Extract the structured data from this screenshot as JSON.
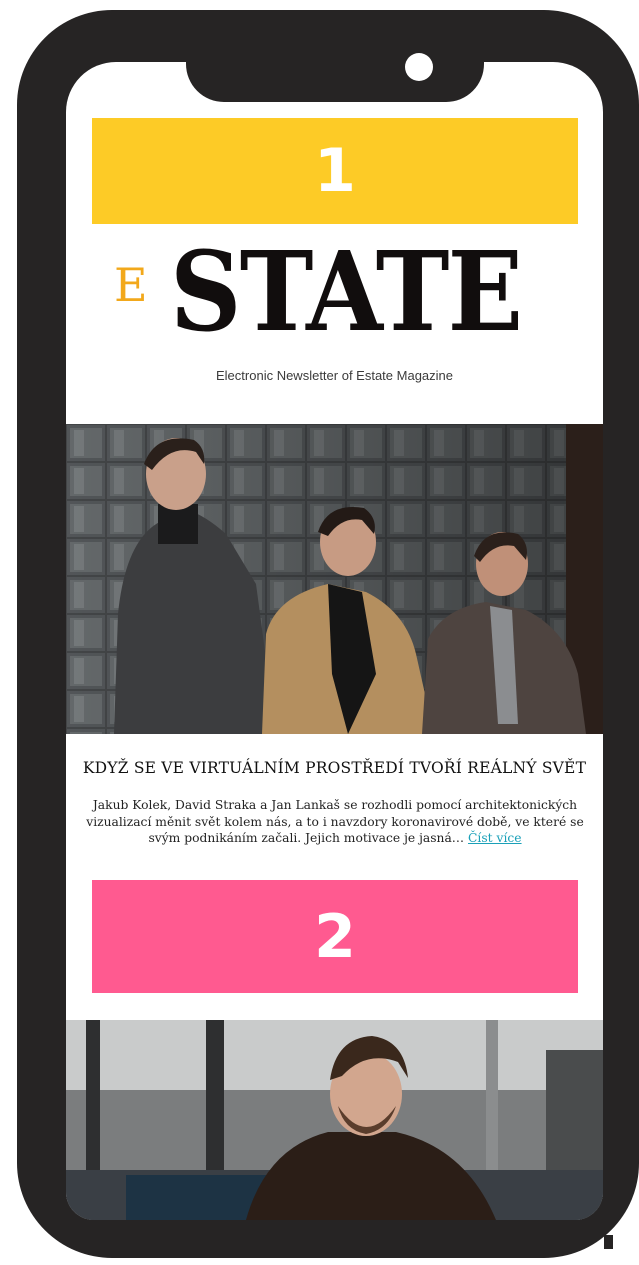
{
  "newsletter": {
    "badges": [
      "1",
      "2"
    ],
    "logo": {
      "initial": "E",
      "word": "STATE"
    },
    "tagline": "Electronic Newsletter of Estate Magazine",
    "article": {
      "title": "KDYŽ SE VE VIRTUÁLNÍM PROSTŘEDÍ TVOŘÍ REÁLNÝ SVĚT",
      "excerpt": "Jakub Kolek, David Straka a Jan Lankaš se rozhodli pomocí architektonických vizualizací měnit svět kolem nás, a to i navzdory koronavirové době, ve které se svým podnikáním začali. Jejich motivace je jasná…",
      "read_more": "Číst více"
    }
  },
  "colors": {
    "phone": "#262424",
    "badge_1": "#fdcb26",
    "badge_2": "#ff5a90",
    "logo_initial": "#f2a81b",
    "link": "#1aa0b8"
  }
}
